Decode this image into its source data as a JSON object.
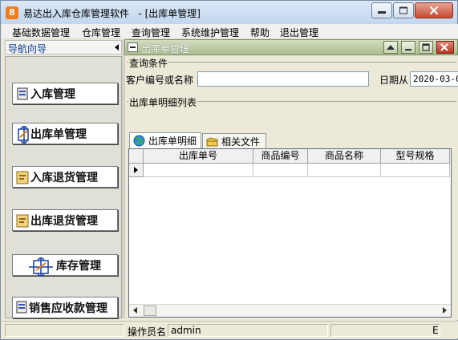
{
  "window": {
    "app_icon_letter": "8",
    "title": "易达出入库仓库管理软件   - [出库单管理]"
  },
  "menu": {
    "items": [
      "基础数据管理",
      "仓库管理",
      "查询管理",
      "系统维护管理",
      "帮助",
      "退出管理"
    ]
  },
  "nav": {
    "header": "导航向导",
    "buttons": [
      "入库管理",
      "出库单管理",
      "入库退货管理",
      "出库退货管理",
      "库存管理",
      "销售应收款管理"
    ]
  },
  "child": {
    "title": "出库单管理"
  },
  "query": {
    "group_label": "查询条件",
    "customer_label": "客户编号或名称",
    "customer_value": "",
    "date_label": "日期从",
    "date_value": "2020-03-0"
  },
  "detail": {
    "group_label": "出库单明细列表",
    "tabs": [
      "出库单明细",
      "相关文件"
    ],
    "columns": [
      "出库单号",
      "商品编号",
      "商品名称",
      "型号规格"
    ]
  },
  "status": {
    "operator_label": "操作员名",
    "operator_value": "admin",
    "right_text": "E"
  },
  "colors": {
    "nav_header_text": "#0a3d9a",
    "child_title_bg": "#a9bd8e",
    "close_button": "#c74a32"
  }
}
